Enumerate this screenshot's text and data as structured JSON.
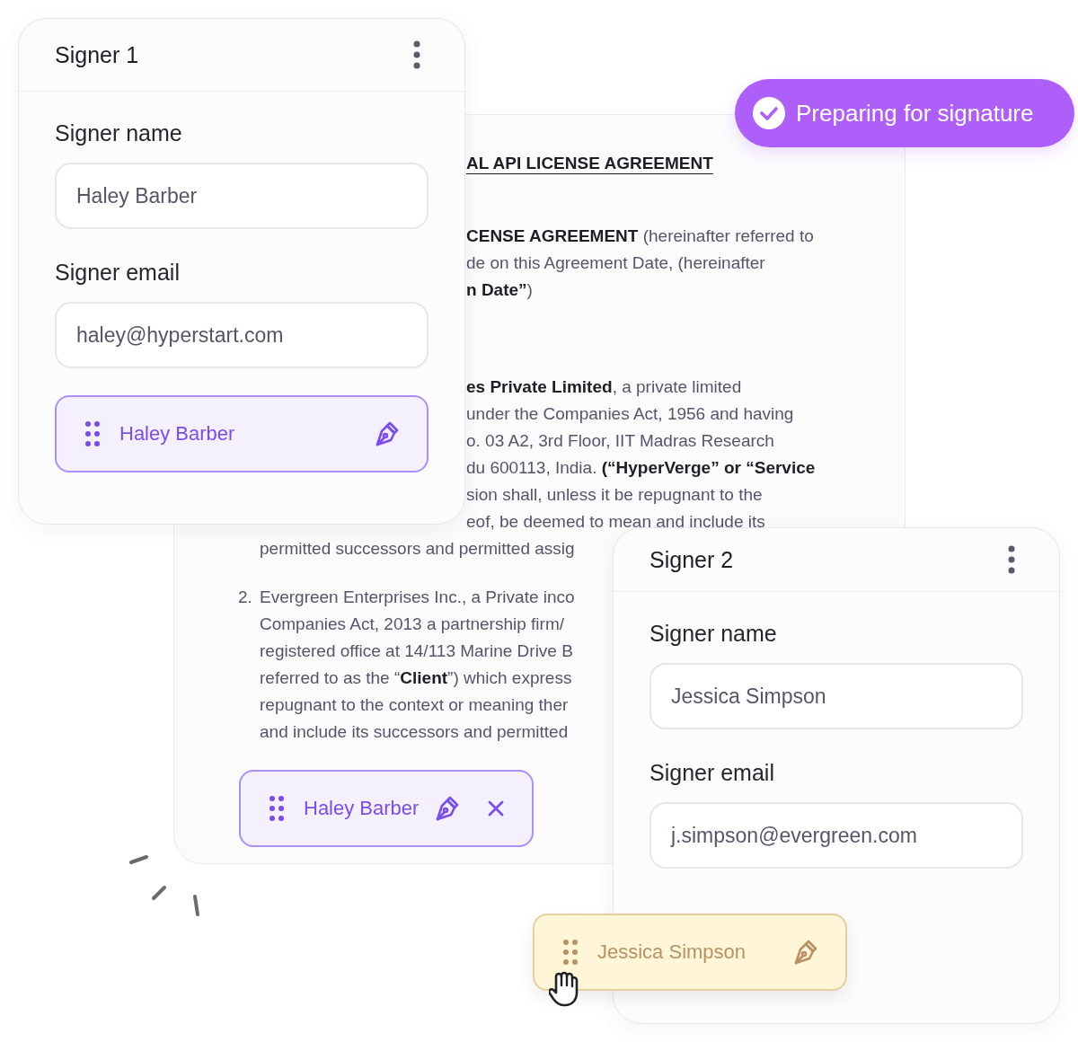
{
  "badge": {
    "label": "Preparing for signature"
  },
  "document": {
    "title": "AL API LICENSE AGREEMENT",
    "paragraphs": [
      {
        "lines": [
          "**CENSE AGREEMENT** (hereinafter referred to",
          "de on this Agreement Date, (hereinafter",
          "**n Date”**)"
        ]
      },
      {
        "lines": [
          "**es Private Limited**, a private limited",
          "under the Companies Act, 1956 and having",
          "o. 03 A2, 3rd Floor, IIT Madras Research",
          "du 600113, India. **(“HyperVerge” or “Service**",
          "sion shall, unless it be repugnant to the",
          "eof, be deemed to mean and include its",
          "permitted successors and permitted assig"
        ]
      },
      {
        "marker": "2.",
        "lines": [
          "Evergreen Enterprises Inc., a Private inco",
          "Companies Act, 2013 a partnership   firm/",
          "registered office at 14/113 Marine Drive B",
          "referred to as the “**Client**”) which express",
          "repugnant to the context or meaning ther",
          "and include its successors and permitted"
        ]
      }
    ],
    "chip": {
      "name": "Haley Barber",
      "removable": true,
      "dragging": false
    }
  },
  "signers": [
    {
      "title": "Signer 1",
      "name_label": "Signer name",
      "name_value": "Haley Barber",
      "email_label": "Signer email",
      "email_value": "haley@hyperstart.com",
      "chip": {
        "name": "Haley Barber",
        "removable": false,
        "dragging": false
      }
    },
    {
      "title": "Signer 2",
      "name_label": "Signer name",
      "name_value": "Jessica Simpson",
      "email_label": "Signer email",
      "email_value": "j.simpson@evergreen.com",
      "chip": {
        "name": "Jessica Simpson",
        "removable": false,
        "dragging": true
      }
    }
  ]
}
